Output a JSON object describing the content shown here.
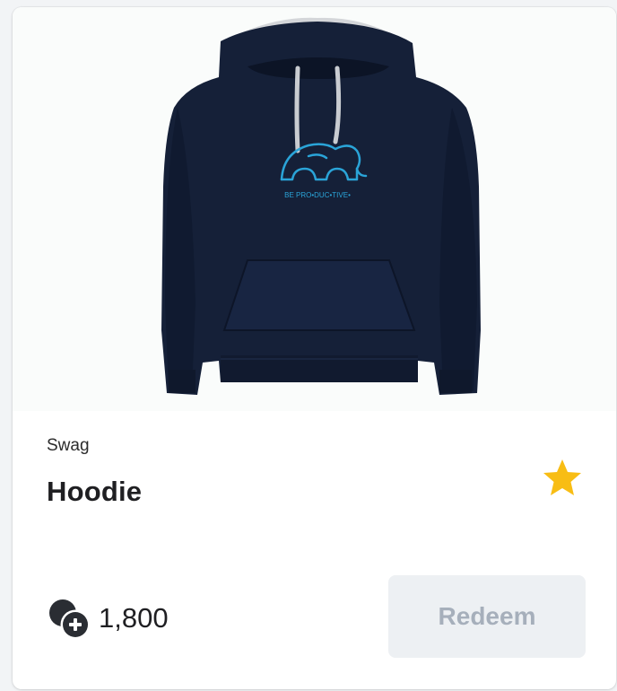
{
  "product": {
    "category": "Swag",
    "name": "Hoodie",
    "print_text": "BE PRO•DUC•TIVE•",
    "favorite": true
  },
  "price": {
    "value": "1,800"
  },
  "actions": {
    "redeem_label": "Redeem",
    "redeem_disabled": true
  },
  "icons": {
    "favorite": "star-icon",
    "currency": "coins-icon"
  },
  "colors": {
    "hoodie": "#152038",
    "hood_lining": "#d4d6d9",
    "print": "#2aa4d8",
    "star": "#f8bd14",
    "button_bg": "#edf0f3",
    "button_text": "#a6afbb"
  }
}
